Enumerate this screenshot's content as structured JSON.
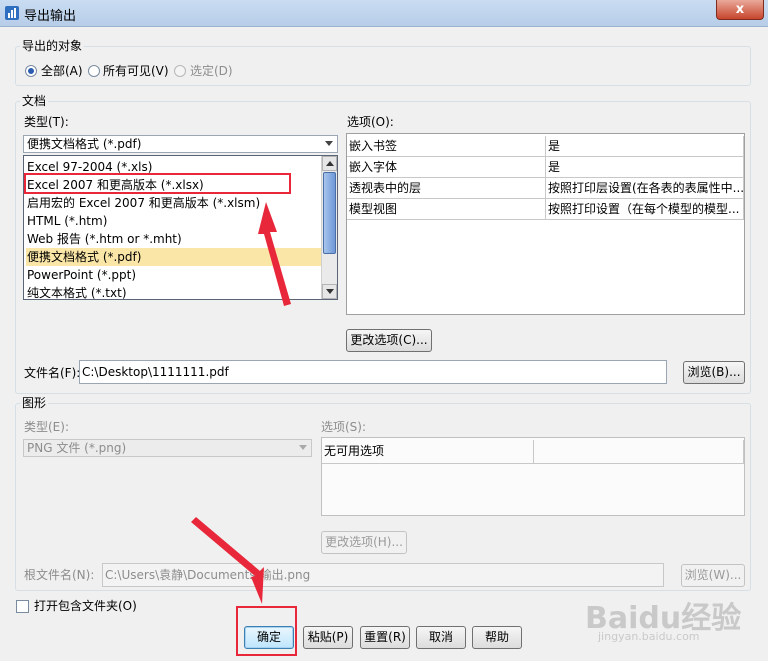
{
  "window": {
    "title": "导出输出",
    "close_glyph": "x"
  },
  "export_object": {
    "legend": "导出的对象",
    "options": [
      {
        "label": "全部(A)",
        "selected": true,
        "enabled": true
      },
      {
        "label": "所有可见(V)",
        "selected": false,
        "enabled": true
      },
      {
        "label": "选定(D)",
        "selected": false,
        "enabled": false
      }
    ]
  },
  "document": {
    "legend": "文档",
    "type_label": "类型(T):",
    "type_value": "便携文档格式 (*.pdf)",
    "type_list": [
      "Excel 97-2004 (*.xls)",
      "Excel 2007 和更高版本 (*.xlsx)",
      "启用宏的 Excel 2007 和更高版本 (*.xlsm)",
      "HTML (*.htm)",
      "Web 报告 (*.htm or *.mht)",
      "便携文档格式 (*.pdf)",
      "PowerPoint (*.ppt)",
      "纯文本格式 (*.txt)"
    ],
    "type_list_selected_index": 5,
    "options_label": "选项(O):",
    "options_rows": [
      {
        "name": "嵌入书签",
        "value": "是"
      },
      {
        "name": "嵌入字体",
        "value": "是"
      },
      {
        "name": "透视表中的层",
        "value": "按照打印层设置(在各表的表属性中..."
      },
      {
        "name": "模型视图",
        "value": "按照打印设置（在每个模型的模型..."
      }
    ],
    "change_options_button": "更改选项(C)...",
    "filename_label": "文件名(F):",
    "filename_value": "C:\\Desktop\\1111111.pdf",
    "browse_button": "浏览(B)..."
  },
  "graphics": {
    "legend": "图形",
    "type_label": "类型(E):",
    "type_value": "PNG 文件 (*.png)",
    "options_label": "选项(S):",
    "options_rows": [
      {
        "name": "无可用选项",
        "value": ""
      }
    ],
    "change_options_button": "更改选项(H)...",
    "root_filename_label": "根文件名(N):",
    "root_filename_value": "C:\\Users\\袁静\\Documents\\输出.png",
    "browse_button": "浏览(W)..."
  },
  "open_folder_label": "打开包含文件夹(O)",
  "footer_buttons": [
    "确定",
    "粘贴(P)",
    "重置(R)",
    "取消",
    "帮助"
  ],
  "watermark": {
    "main": "Baidu经验",
    "sub": "jingyan.baidu.com"
  },
  "colors": {
    "highlight": "#e8283a",
    "selection": "#fae7a8"
  }
}
